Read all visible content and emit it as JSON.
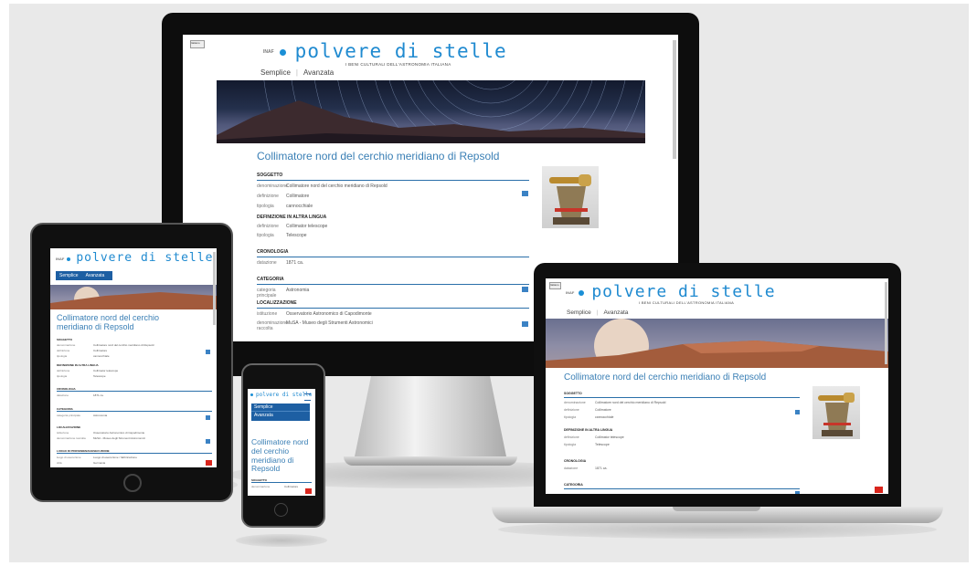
{
  "site": {
    "inaf": "INAF",
    "logo": "polvere di stelle",
    "tagline": "I BENI CULTURALI DELL'ASTRONOMIA ITALIANA",
    "nav": [
      "Semplice",
      "Avanzata"
    ],
    "lang_button": "Italiano",
    "page_title": "Collimatore nord del cerchio meridiano di Repsold",
    "sections": {
      "soggetto": {
        "heading": "SOGGETTO",
        "rows": [
          {
            "k": "denominazione",
            "v": "Collimatore nord del cerchio meridiano di Repsold"
          },
          {
            "k": "definizione",
            "v": "Collimatore"
          },
          {
            "k": "tipologia",
            "v": "cannocchiale"
          }
        ]
      },
      "altra_lingua": {
        "heading": "DEFINIZIONE IN ALTRA LINGUA",
        "rows": [
          {
            "k": "definizione",
            "v": "Collimator telescope"
          },
          {
            "k": "tipologia",
            "v": "Telescope"
          }
        ]
      },
      "cronologia": {
        "heading": "CRONOLOGIA",
        "rows": [
          {
            "k": "datazione",
            "v": "1871 ca."
          }
        ]
      },
      "categoria": {
        "heading": "CATEGORIA",
        "rows": [
          {
            "k": "categoria principale",
            "v": "Astronomia"
          }
        ]
      },
      "localizzazione": {
        "heading": "LOCALIZZAZIONE",
        "rows": [
          {
            "k": "istituzione",
            "v": "Osservatorio Astronomico di Capodimonte"
          },
          {
            "k": "denominazione raccolta",
            "v": "MuSA - Museo degli Strumenti Astronomici"
          }
        ]
      },
      "provenienza": {
        "heading": "LUOGO DI PROVENIENZA/ESECUZIONE",
        "rows": [
          {
            "k": "luogo di esecuzione",
            "v": "Luogo di esecuzione / fabbricazione"
          },
          {
            "k": "città",
            "v": "Germania"
          }
        ]
      }
    }
  },
  "colors": {
    "brand_blue": "#1f8ad0",
    "title_blue": "#3a7fb5",
    "nav_blue": "#1d5fa3",
    "red_button": "#d9251c",
    "background": "#e9e9e9"
  }
}
